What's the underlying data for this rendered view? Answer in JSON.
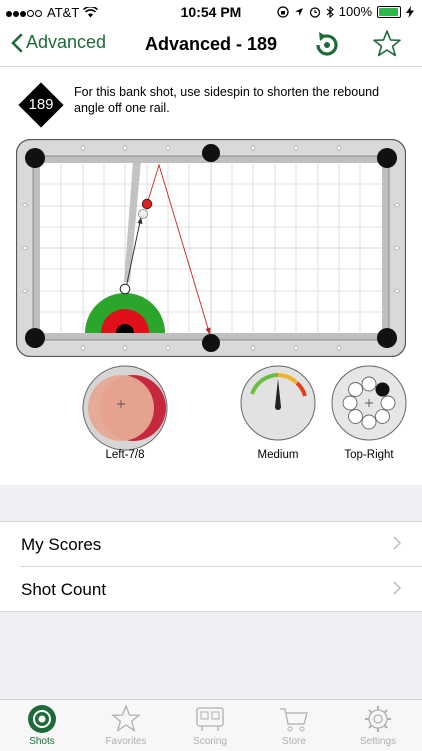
{
  "status_bar": {
    "carrier": "AT&T",
    "time": "10:54 PM",
    "battery": "100%"
  },
  "nav": {
    "back_label": "Advanced",
    "title": "Advanced - 189"
  },
  "shot": {
    "number": "189",
    "description": "For this bank shot, use sidespin to shorten the rebound angle off one rail."
  },
  "controls": {
    "cut_label": "Left-7/8",
    "speed_label": "Medium",
    "spin_label": "Top-Right"
  },
  "list": [
    {
      "label": "My Scores"
    },
    {
      "label": "Shot Count"
    }
  ],
  "tabs": [
    {
      "label": "Shots",
      "icon": "shots-icon",
      "active": true
    },
    {
      "label": "Favorites",
      "icon": "star-icon",
      "active": false
    },
    {
      "label": "Scoring",
      "icon": "scoreboard-icon",
      "active": false
    },
    {
      "label": "Store",
      "icon": "cart-icon",
      "active": false
    },
    {
      "label": "Settings",
      "icon": "gear-icon",
      "active": false
    }
  ],
  "colors": {
    "accent": "#1e6b3a",
    "target_ball": "#e02020",
    "target_zone_green": "#2ca52c",
    "target_zone_red": "#e0101a"
  }
}
